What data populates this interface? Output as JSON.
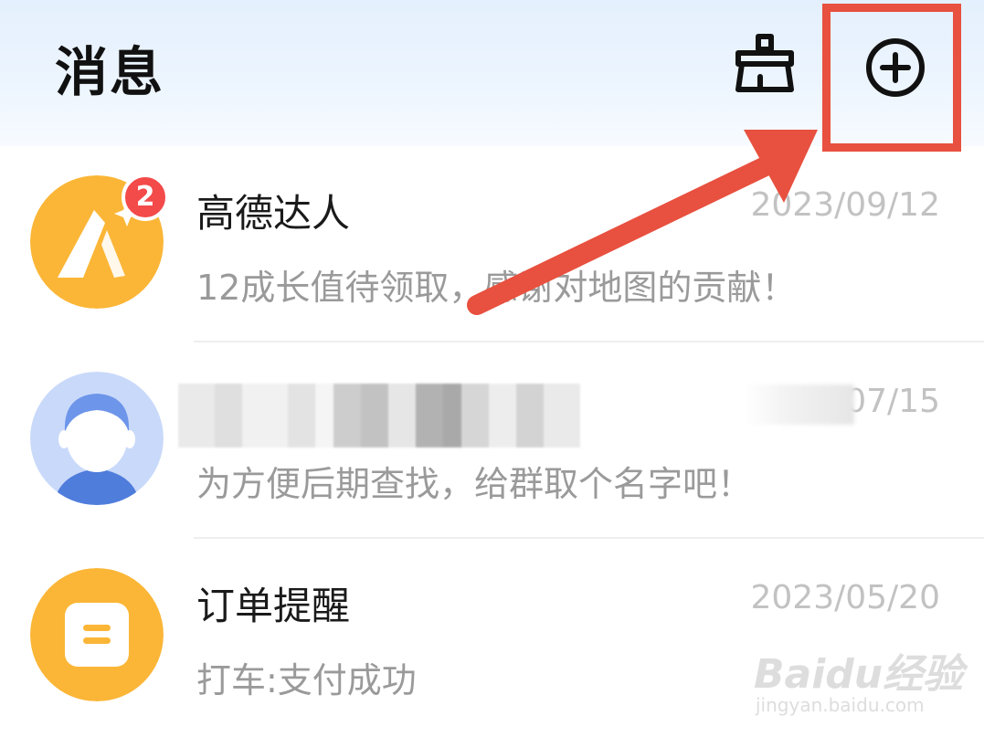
{
  "header": {
    "title": "消息",
    "clean_icon": "broom-icon",
    "add_icon": "plus-circle-icon"
  },
  "conversations": [
    {
      "name": "高德达人",
      "date": "2023/09/12",
      "preview": "12成长值待领取，感谢对地图的贡献！",
      "unread": "2",
      "avatar": "amap-expert-avatar",
      "avatar_color": "#fbb637"
    },
    {
      "name": "",
      "date": "2023/07/15",
      "preview": "为方便后期查找，给群取个名字吧！",
      "avatar": "user-avatar",
      "avatar_color": "#c9d9fa"
    },
    {
      "name": "订单提醒",
      "date": "2023/05/20",
      "preview": "打车:支付成功",
      "avatar": "order-avatar",
      "avatar_color": "#fbb637"
    }
  ],
  "annotation": {
    "color": "#e8503f"
  },
  "watermark": {
    "logo": "Baidu经验",
    "url": "jingyan.baidu.com"
  }
}
